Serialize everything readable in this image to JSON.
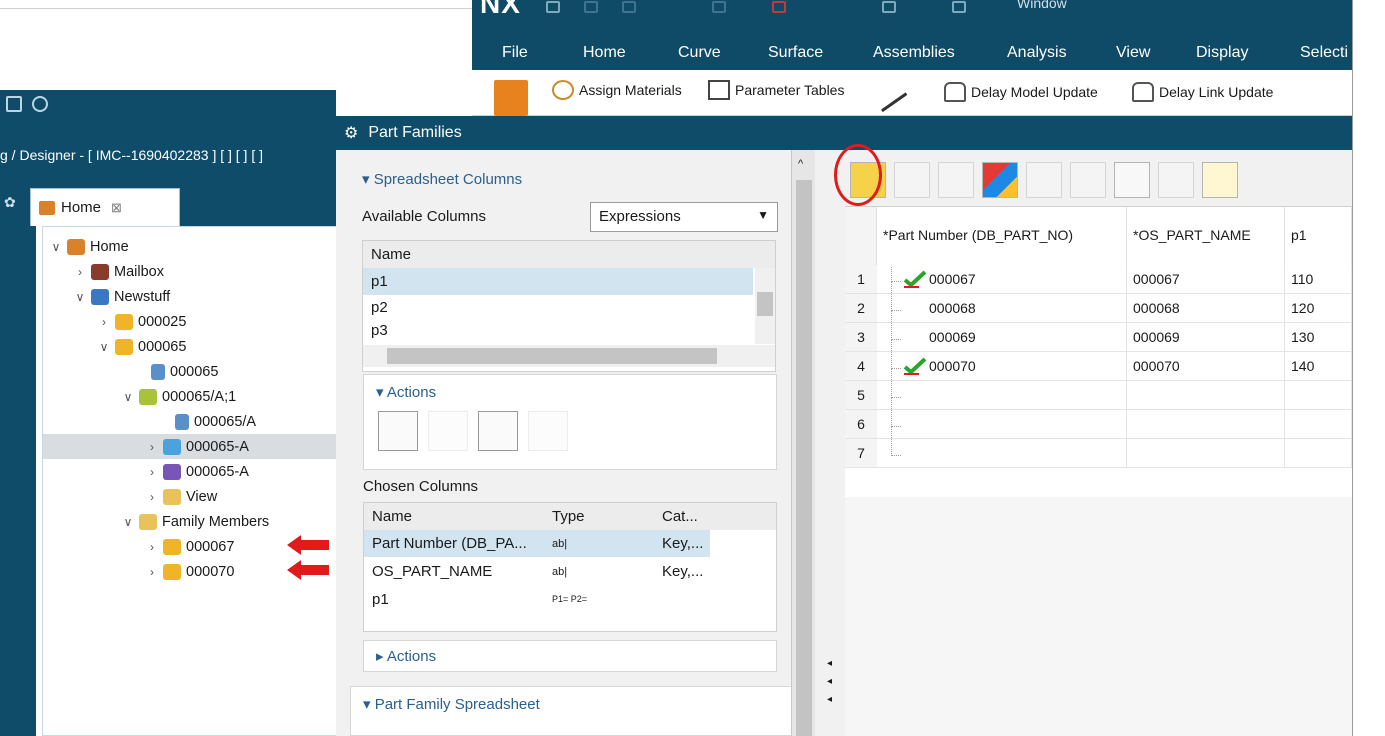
{
  "nx": {
    "logo": "NX",
    "window_menu": "Window",
    "menu": [
      "File",
      "Home",
      "Curve",
      "Surface",
      "Assemblies",
      "Analysis",
      "View",
      "Display",
      "Selecti"
    ],
    "toolbar": {
      "assign_materials": "Assign Materials",
      "parameter_tables": "Parameter Tables",
      "delay_model_update": "Delay Model Update",
      "delay_link_update": "Delay Link Update"
    }
  },
  "left": {
    "breadcrumb": "g / Designer - [ IMC--1690402283 ] [ ] [ ] [ ]",
    "home_tab": "Home",
    "tree": [
      {
        "label": "Home",
        "arrow": "∨",
        "icon_color": "#d9822b"
      },
      {
        "label": "Mailbox",
        "arrow": "›",
        "icon_color": "#8a3c2c"
      },
      {
        "label": "Newstuff",
        "arrow": "∨",
        "icon_color": "#3a78c4"
      },
      {
        "label": "000025",
        "arrow": "›",
        "icon_color": "#f0b429"
      },
      {
        "label": "000065",
        "arrow": "∨",
        "icon_color": "#f0b429"
      },
      {
        "label": "000065",
        "arrow": "",
        "icon_color": "#5b8fc9"
      },
      {
        "label": "000065/A;1",
        "arrow": "∨",
        "icon_color": "#a8c23a"
      },
      {
        "label": "000065/A",
        "arrow": "",
        "icon_color": "#5b8fc9"
      },
      {
        "label": "000065-A",
        "arrow": "›",
        "icon_color": "#4aa3df"
      },
      {
        "label": "000065-A",
        "arrow": "›",
        "icon_color": "#7a55b8"
      },
      {
        "label": "View",
        "arrow": "›",
        "icon_color": "#e9c35a"
      },
      {
        "label": "Family Members",
        "arrow": "∨",
        "icon_color": "#e9c35a"
      },
      {
        "label": "000067",
        "arrow": "›",
        "icon_color": "#f0b429"
      },
      {
        "label": "000070",
        "arrow": "›",
        "icon_color": "#f0b429"
      }
    ]
  },
  "dialog": {
    "title": "Part Families",
    "spreadsheet_columns": {
      "header": "Spreadsheet Columns",
      "available_label": "Available Columns",
      "dropdown_value": "Expressions",
      "list_header": "Name",
      "items": [
        "p1",
        "p2",
        "p3"
      ]
    },
    "actions": {
      "header": "Actions"
    },
    "chosen": {
      "label": "Chosen Columns",
      "headers": [
        "Name",
        "Type",
        "Cat..."
      ],
      "rows": [
        {
          "name": "Part Number (DB_PA...",
          "type": "ab|",
          "cat": "Key,..."
        },
        {
          "name": "OS_PART_NAME",
          "type": "ab|",
          "cat": "Key,..."
        },
        {
          "name": "p1",
          "type": "P1= P2=",
          "cat": ""
        }
      ]
    },
    "actions2": {
      "header": "Actions"
    },
    "part_family_spreadsheet": {
      "header": "Part Family Spreadsheet"
    }
  },
  "sheet": {
    "headers": [
      "*Part Number (DB_PART_NO)",
      "*OS_PART_NAME",
      "p1"
    ],
    "row_numbers": [
      "1",
      "2",
      "3",
      "4",
      "5",
      "6",
      "7"
    ],
    "rows": [
      {
        "part": "000067",
        "name": "000067",
        "p1": "110",
        "checked": true
      },
      {
        "part": "000068",
        "name": "000068",
        "p1": "120",
        "checked": false
      },
      {
        "part": "000069",
        "name": "000069",
        "p1": "130",
        "checked": false
      },
      {
        "part": "000070",
        "name": "000070",
        "p1": "140",
        "checked": true
      }
    ]
  }
}
